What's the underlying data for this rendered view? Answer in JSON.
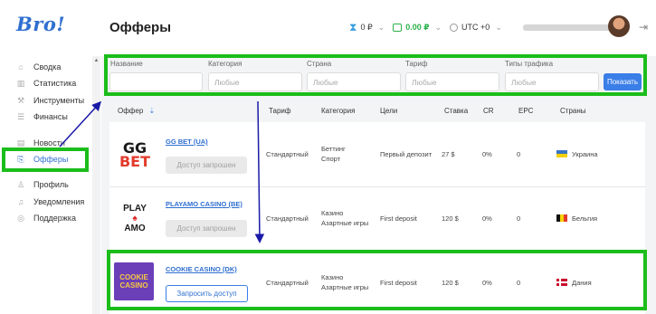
{
  "app": {
    "logo_text": "Bro!",
    "page_title": "Офферы",
    "accent_color": "#2f6fd0",
    "annotation_color": "#1bbd1b",
    "arrow_color": "#1a1aa8"
  },
  "topbar": {
    "hold_balance": "0 ₽",
    "balance": "0.00 ₽",
    "timezone": "UTC +0",
    "icons": [
      "hourglass-icon",
      "wallet-icon",
      "clock-icon",
      "logout-icon"
    ]
  },
  "sidebar": {
    "items": [
      {
        "label": "Сводка",
        "icon": "home-icon"
      },
      {
        "label": "Статистика",
        "icon": "bar-chart-icon"
      },
      {
        "label": "Инструменты",
        "icon": "tools-icon"
      },
      {
        "label": "Финансы",
        "icon": "database-icon"
      },
      {
        "label": "Новости",
        "icon": "news-icon"
      },
      {
        "label": "Офферы",
        "icon": "offers-icon",
        "active": true
      },
      {
        "label": "Профиль",
        "icon": "user-icon"
      },
      {
        "label": "Уведомления",
        "icon": "bell-icon"
      },
      {
        "label": "Поддержка",
        "icon": "support-icon"
      }
    ]
  },
  "filters": {
    "name_label": "Название",
    "category_label": "Категория",
    "country_label": "Страна",
    "tariff_label": "Тариф",
    "traffic_label": "Типы трафика",
    "name_value": "",
    "any_placeholder": "Любые",
    "show_button": "Показать"
  },
  "table": {
    "columns": [
      "Оффер",
      "Тариф",
      "Категория",
      "Цели",
      "Ставка",
      "CR",
      "EPC",
      "Страны"
    ],
    "sort_indicator": "⇣",
    "rows": [
      {
        "name": "GG BET (UA)",
        "logo": "GG BET",
        "action": "Доступ запрошен",
        "action_enabled": false,
        "tariff": "Стандартный",
        "category_line1": "Беттинг",
        "category_line2": "Спорт",
        "goal": "Первый депозит",
        "rate": "27 $",
        "cr": "0%",
        "epc": "0",
        "country": "Украина"
      },
      {
        "name": "PLAYAMO CASINO (BE)",
        "logo": "PLAY AMO",
        "action": "Доступ запрошен",
        "action_enabled": false,
        "tariff": "Стандартный",
        "category_line1": "Казино",
        "category_line2": "Азартные игры",
        "goal": "First deposit",
        "rate": "120 $",
        "cr": "0%",
        "epc": "0",
        "country": "Бельгия"
      },
      {
        "name": "COOKIE CASINO (DK)",
        "logo": "COOKIE CASINO",
        "action": "Запросить доступ",
        "action_enabled": true,
        "tariff": "Стандартный",
        "category_line1": "Казино",
        "category_line2": "Азартные игры",
        "goal": "First deposit",
        "rate": "120 $",
        "cr": "0%",
        "epc": "0",
        "country": "Дания"
      }
    ]
  }
}
